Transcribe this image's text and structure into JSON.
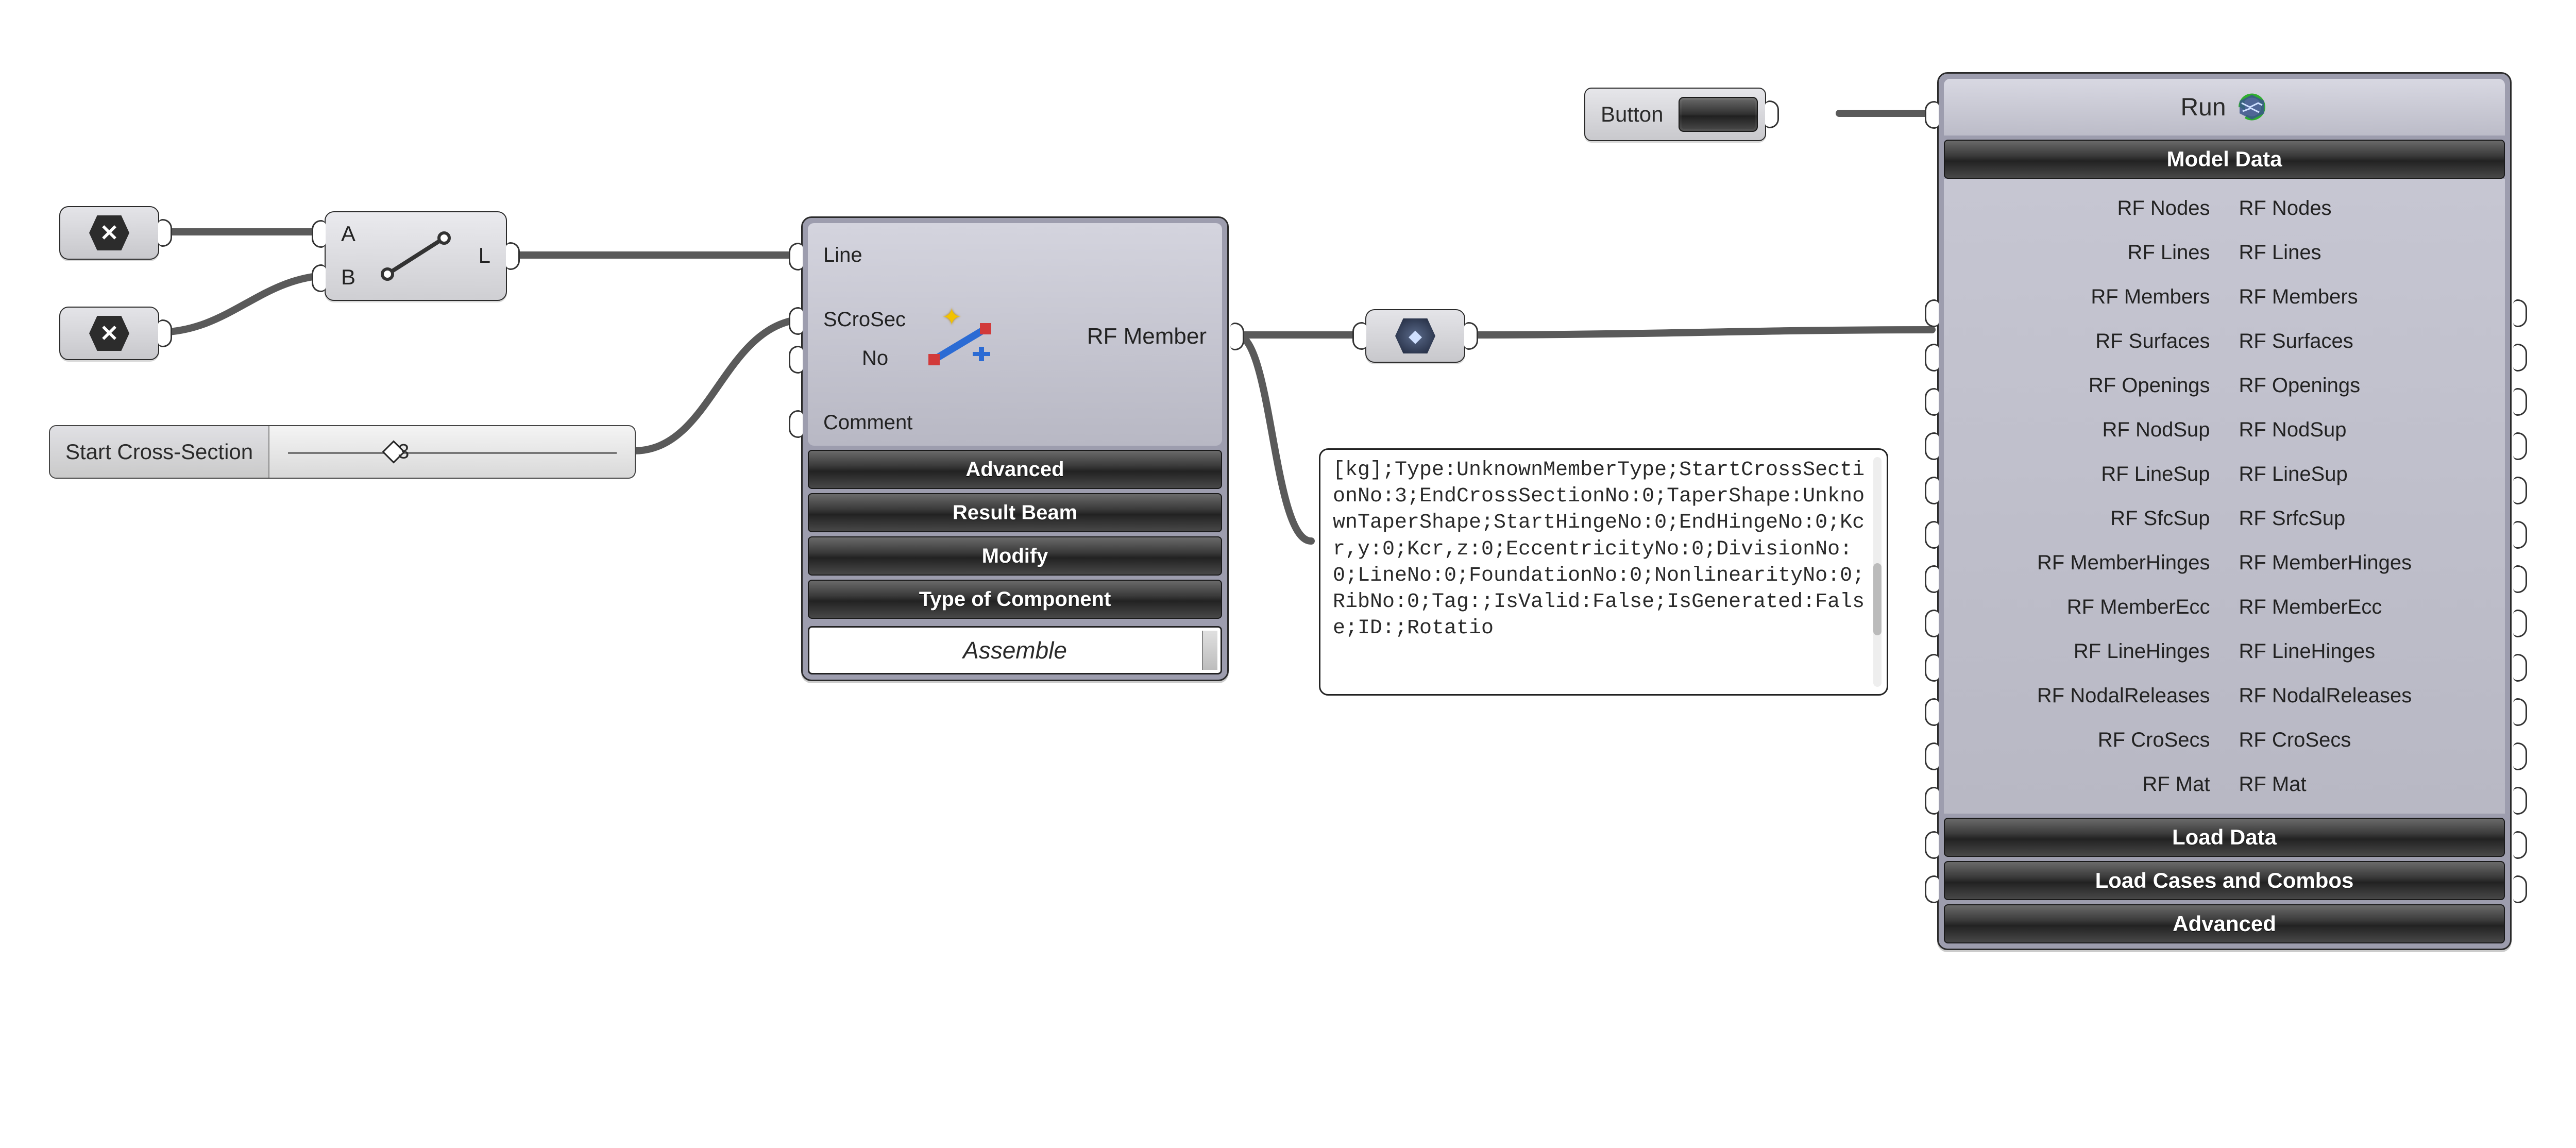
{
  "point_nodes": {
    "a": {
      "icon": "x-icon"
    },
    "b": {
      "icon": "x-icon"
    },
    "relay": {
      "icon": "globe-icon"
    }
  },
  "line_comp": {
    "inputs": [
      "A",
      "B"
    ],
    "outputs": [
      "L"
    ]
  },
  "start_section_slider": {
    "label": "Start Cross-Section",
    "value": "3"
  },
  "rf_member": {
    "inputs": [
      "Line",
      "SCroSec",
      "No",
      "Comment"
    ],
    "output": "RF Member",
    "bars": [
      "Advanced",
      "Result Beam",
      "Modify",
      "Type of Component"
    ],
    "assemble": "Assemble"
  },
  "text_panel": {
    "content": "[kg];Type:UnknownMemberType;StartCrossSectionNo:3;EndCrossSectionNo:0;TaperShape:UnknownTaperShape;StartHingeNo:0;EndHingeNo:0;Kcr,y:0;Kcr,z:0;EccentricityNo:0;DivisionNo:0;LineNo:0;FoundationNo:0;NonlinearityNo:0;RibNo:0;Tag:;IsValid:False;IsGenerated:False;ID:;Rotatio"
  },
  "button_comp": {
    "label": "Button"
  },
  "run_comp": {
    "title": "Run",
    "sections": {
      "model_data": {
        "title": "Model Data",
        "rows": [
          "RF Nodes",
          "RF Lines",
          "RF Members",
          "RF Surfaces",
          "RF Openings",
          "RF NodSup",
          "RF LineSup",
          "RF SfcSup",
          "RF MemberHinges",
          "RF MemberEcc",
          "RF LineHinges",
          "RF NodalReleases",
          "RF CroSecs",
          "RF Mat"
        ],
        "out_override": {
          "7": "RF SrfcSup"
        }
      },
      "load_data": {
        "title": "Load Data"
      },
      "load_cases": {
        "title": "Load Cases and Combos"
      },
      "advanced": {
        "title": "Advanced"
      }
    }
  }
}
